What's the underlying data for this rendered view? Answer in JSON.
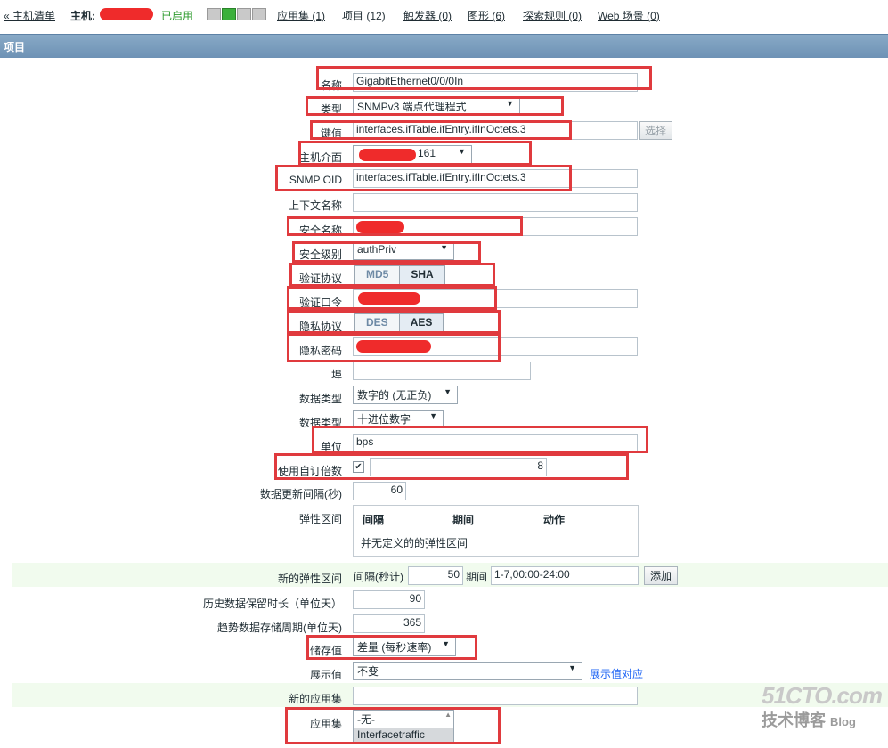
{
  "topbar": {
    "host_list_link": "« 主机清单",
    "host_label": "主机:",
    "status_enabled": "已启用",
    "availability_icons": [
      "zbx-icon",
      "snmp-icon",
      "jmx-icon",
      "ipmi-icon"
    ],
    "links": [
      "应用集 (1)",
      "项目 (12)",
      "触发器 (0)",
      "图形 (6)",
      "探索规则 (0)",
      "Web 场景 (0)"
    ]
  },
  "section_title": "项目",
  "form": {
    "name_label": "名称",
    "name_value": "GigabitEthernet0/0/0In",
    "type_label": "类型",
    "type_value": "SNMPv3 端点代理程式",
    "key_label": "键值",
    "key_value": "interfaces.ifTable.ifEntry.ifInOctets.3",
    "select_button": "选择",
    "host_interface_label": "主机介面",
    "host_interface_port": "161",
    "snmp_oid_label": "SNMP OID",
    "snmp_oid_value": "interfaces.ifTable.ifEntry.ifInOctets.3",
    "context_name_label": "上下文名称",
    "security_name_label": "安全名称",
    "security_level_label": "安全级别",
    "security_level_value": "authPriv",
    "auth_protocol_label": "验证协议",
    "auth_protocol_options": [
      "MD5",
      "SHA"
    ],
    "auth_passphrase_label": "验证口令",
    "privacy_protocol_label": "隐私协议",
    "privacy_protocol_options": [
      "DES",
      "AES"
    ],
    "privacy_passphrase_label": "隐私密码",
    "port_label": "埠",
    "type_of_info_label": "数据类型",
    "type_of_info_value": "数字的 (无正负)",
    "data_type_label": "数据类型",
    "data_type_value": "十进位数字",
    "units_label": "单位",
    "units_value": "bps",
    "multiplier_label": "使用自订倍数",
    "multiplier_value": "8",
    "update_interval_label": "数据更新间隔(秒)",
    "update_interval_value": "60",
    "flex_label": "弹性区间",
    "flex_headers": [
      "间隔",
      "期间",
      "动作"
    ],
    "flex_empty": "并无定义的的弹性区间",
    "new_flex_label": "新的弹性区间",
    "new_flex_interval_label": "间隔(秒计)",
    "new_flex_interval_value": "50",
    "new_flex_period_label": "期间",
    "new_flex_period_value": "1-7,00:00-24:00",
    "add_button": "添加",
    "history_label": "历史数据保留时长（单位天）",
    "history_value": "90",
    "trends_label": "趋势数据存储周期(单位天)",
    "trends_value": "365",
    "store_value_label": "储存值",
    "store_value_value": "差量 (每秒速率)",
    "show_value_label": "展示值",
    "show_value_value": "不变",
    "value_mapping_link": "展示值对应",
    "new_application_label": "新的应用集",
    "applications_label": "应用集",
    "applications_options": [
      "-无-",
      "Interfacetraffic"
    ]
  },
  "watermark": {
    "brand": "51CTO.com",
    "sub1": "技术博客",
    "sub2": "Blog"
  },
  "colors": {
    "accent_red": "#e03a3e",
    "title_bar": "#7a9cbd",
    "link": "#1f65f4",
    "enabled_green": "#2c9a2c"
  }
}
